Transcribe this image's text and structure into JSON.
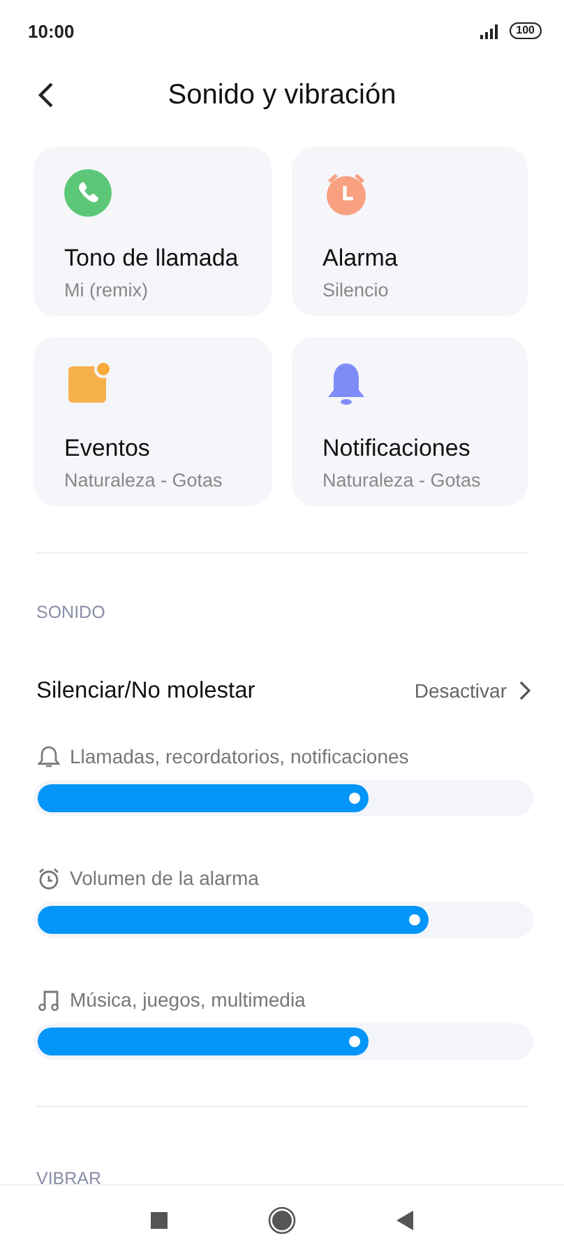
{
  "status_bar": {
    "time": "10:00",
    "battery": "100"
  },
  "header": {
    "title": "Sonido y vibración"
  },
  "cards": [
    {
      "kind": "phone",
      "title": "Tono de llamada",
      "subtitle": "Mi (remix)"
    },
    {
      "kind": "alarm",
      "title": "Alarma",
      "subtitle": "Silencio"
    },
    {
      "kind": "calendar",
      "title": "Eventos",
      "subtitle": "Naturaleza - Gotas"
    },
    {
      "kind": "bell",
      "title": "Notificaciones",
      "subtitle": "Naturaleza - Gotas"
    }
  ],
  "sections": [
    {
      "title": "SONIDO"
    }
  ],
  "dnd": {
    "label": "Silenciar/No molestar",
    "value": "Desactivar"
  },
  "volumes": [
    {
      "kind": "bell",
      "label": "Llamadas, recordatorios, notificaciones",
      "level": 0.68
    },
    {
      "kind": "alarm",
      "label": "Volumen de la alarma",
      "level": 0.8
    },
    {
      "kind": "music",
      "label": "Música, juegos, multimedia",
      "level": 0.68
    }
  ],
  "next_section": {
    "title": "VIBRAR"
  }
}
